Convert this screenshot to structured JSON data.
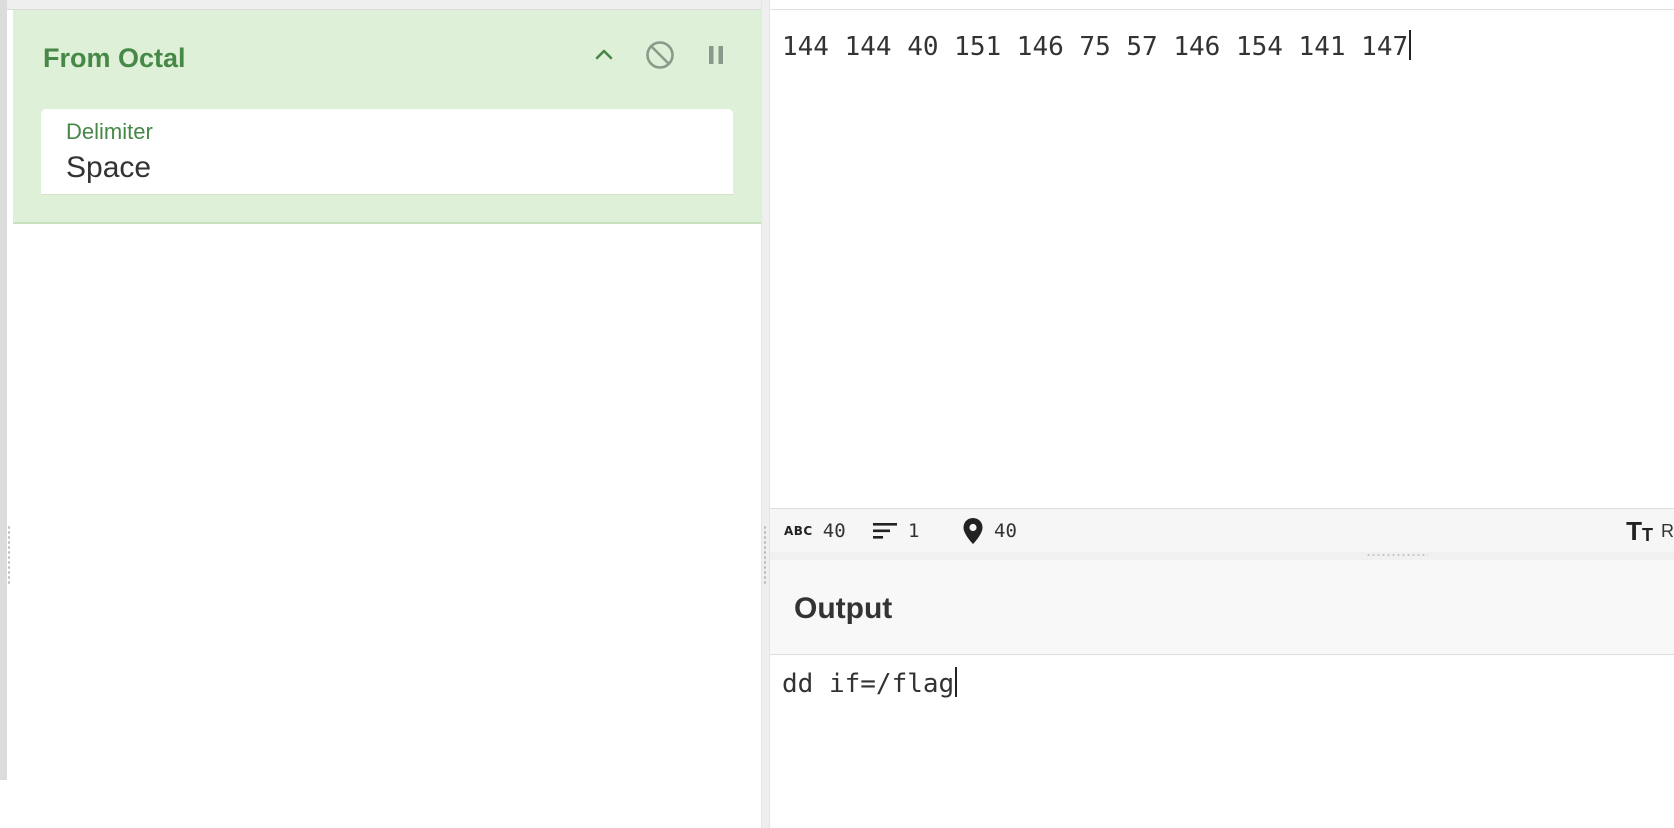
{
  "recipe": {
    "operation": {
      "title": "From Octal",
      "argument": {
        "label": "Delimiter",
        "value": "Space"
      }
    }
  },
  "input": {
    "text": "144 144 40 151 146 75 57 146 154 141 147",
    "status": {
      "length": "40",
      "lines": "1",
      "position": "40"
    },
    "font_label": "R"
  },
  "output": {
    "title": "Output",
    "text": "dd if=/flag"
  },
  "colors": {
    "card_background": "#dff0d8",
    "card_accent": "#468847",
    "text": "#333333"
  }
}
